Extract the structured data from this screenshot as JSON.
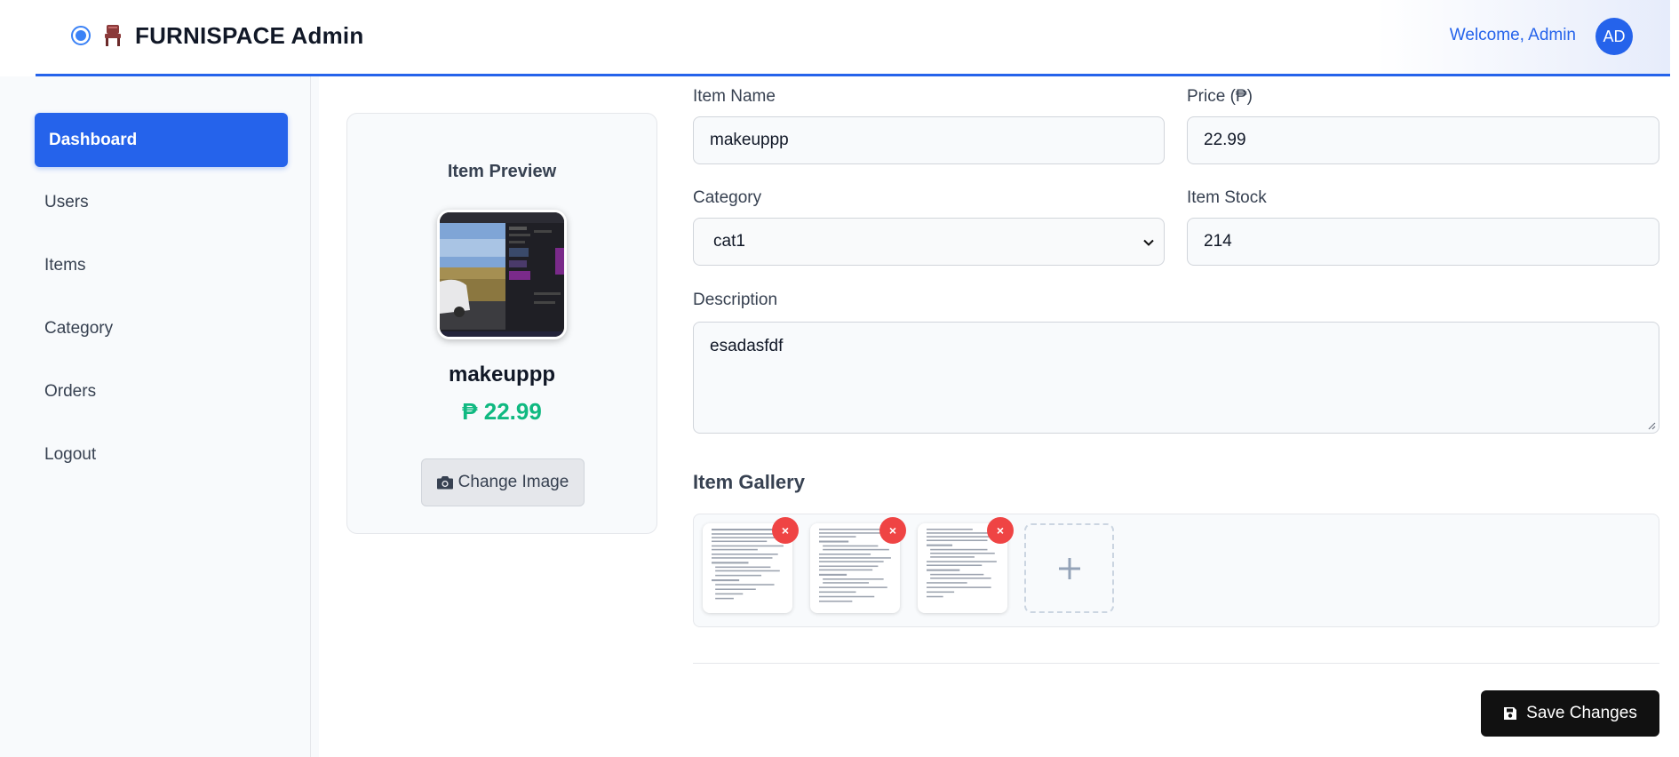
{
  "header": {
    "brand_title": "FURNISPACE Admin",
    "welcome": "Welcome, Admin",
    "avatar_initials": "AD",
    "accent": "#2563eb"
  },
  "sidebar": {
    "items": [
      {
        "label": "Dashboard",
        "active": true
      },
      {
        "label": "Users"
      },
      {
        "label": "Items"
      },
      {
        "label": "Category"
      },
      {
        "label": "Orders"
      },
      {
        "label": "Logout"
      }
    ]
  },
  "preview": {
    "title": "Item Preview",
    "name": "makeuppp",
    "price": "₱ 22.99",
    "change_image_label": "Change Image"
  },
  "form": {
    "item_name": {
      "label": "Item Name",
      "value": "makeuppp"
    },
    "price": {
      "label": "Price (₱)",
      "value": "22.99"
    },
    "category": {
      "label": "Category",
      "value": "cat1"
    },
    "stock": {
      "label": "Item Stock",
      "value": "214"
    },
    "description": {
      "label": "Description",
      "value": "esadasfdf"
    }
  },
  "gallery": {
    "title": "Item Gallery",
    "remove_label": "×",
    "thumbnails": 3
  },
  "actions": {
    "save_label": "Save Changes"
  },
  "colors": {
    "price_green": "#10b981",
    "remove_red": "#ef4444",
    "save_black": "#111111"
  }
}
